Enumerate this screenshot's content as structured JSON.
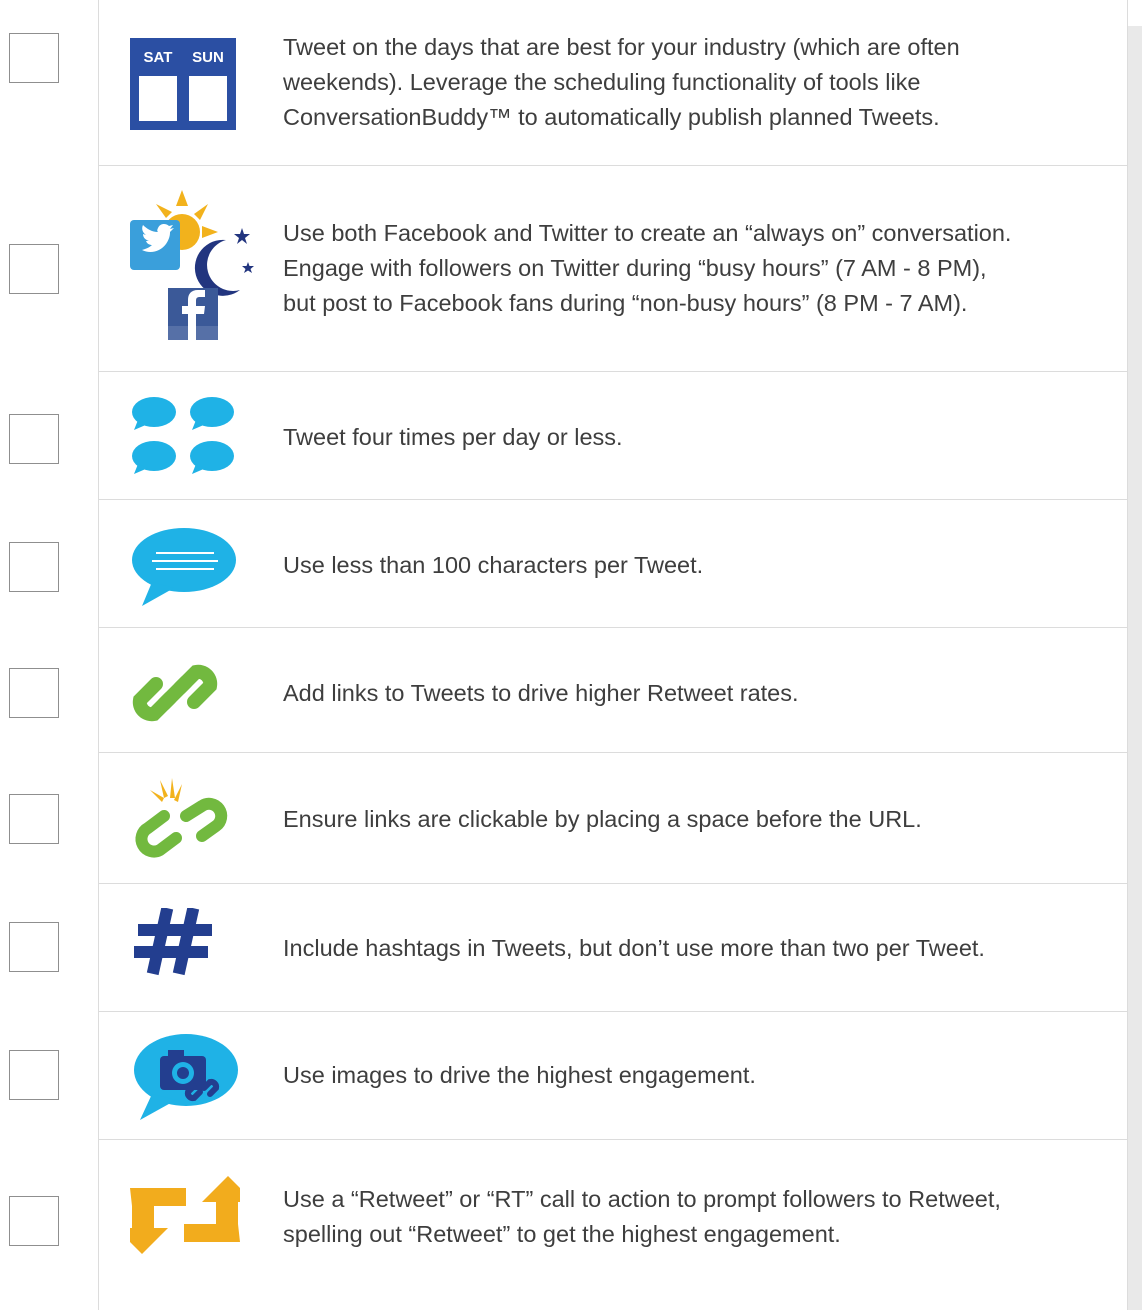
{
  "checklist": {
    "items": [
      {
        "icon": "weekend-calendar-icon",
        "calendar_days": [
          "SAT",
          "SUN"
        ],
        "text": "Tweet on the days that are best for your industry (which are often\nweekends). Leverage the scheduling functionality of tools like\nConversationBuddy™ to automatically publish planned Tweets.",
        "checked": false
      },
      {
        "icon": "twitter-facebook-day-night-icon",
        "text": "Use both Facebook and Twitter to create an “always on” conversation.\nEngage with followers on Twitter during “busy hours” (7 AM - 8 PM),\nbut post to Facebook fans during “non-busy hours” (8 PM - 7 AM).",
        "checked": false
      },
      {
        "icon": "four-speech-bubbles-icon",
        "text": "Tweet four times per day or less.",
        "checked": false
      },
      {
        "icon": "short-message-bubble-icon",
        "text": "Use less than 100 characters per Tweet.",
        "checked": false
      },
      {
        "icon": "link-chain-icon",
        "text": "Add links to Tweets to drive higher Retweet rates.",
        "checked": false
      },
      {
        "icon": "broken-link-icon",
        "text": "Ensure links are clickable by placing a space before the URL.",
        "checked": false
      },
      {
        "icon": "hashtag-icon",
        "text": "Include hashtags in Tweets, but don’t use more than two per Tweet.",
        "checked": false
      },
      {
        "icon": "camera-link-bubble-icon",
        "text": "Use images to drive the highest engagement.",
        "checked": false
      },
      {
        "icon": "retweet-arrows-icon",
        "text": "Use a “Retweet” or “RT” call to action to prompt followers to Retweet,\nspelling out “Retweet” to get the highest engagement.",
        "checked": false
      }
    ]
  },
  "colors": {
    "calendar_blue": "#2b4fa3",
    "twitter_blue": "#3a9fdb",
    "facebook_blue": "#3b5998",
    "sun_yellow": "#f2b21c",
    "bubble_cyan": "#1fb2e6",
    "link_green": "#72b93f",
    "hashtag_navy": "#233e8f",
    "retweet_orange": "#f2ac1d",
    "border_gray": "#dcdcdc",
    "text_gray": "#3e3e3e"
  }
}
